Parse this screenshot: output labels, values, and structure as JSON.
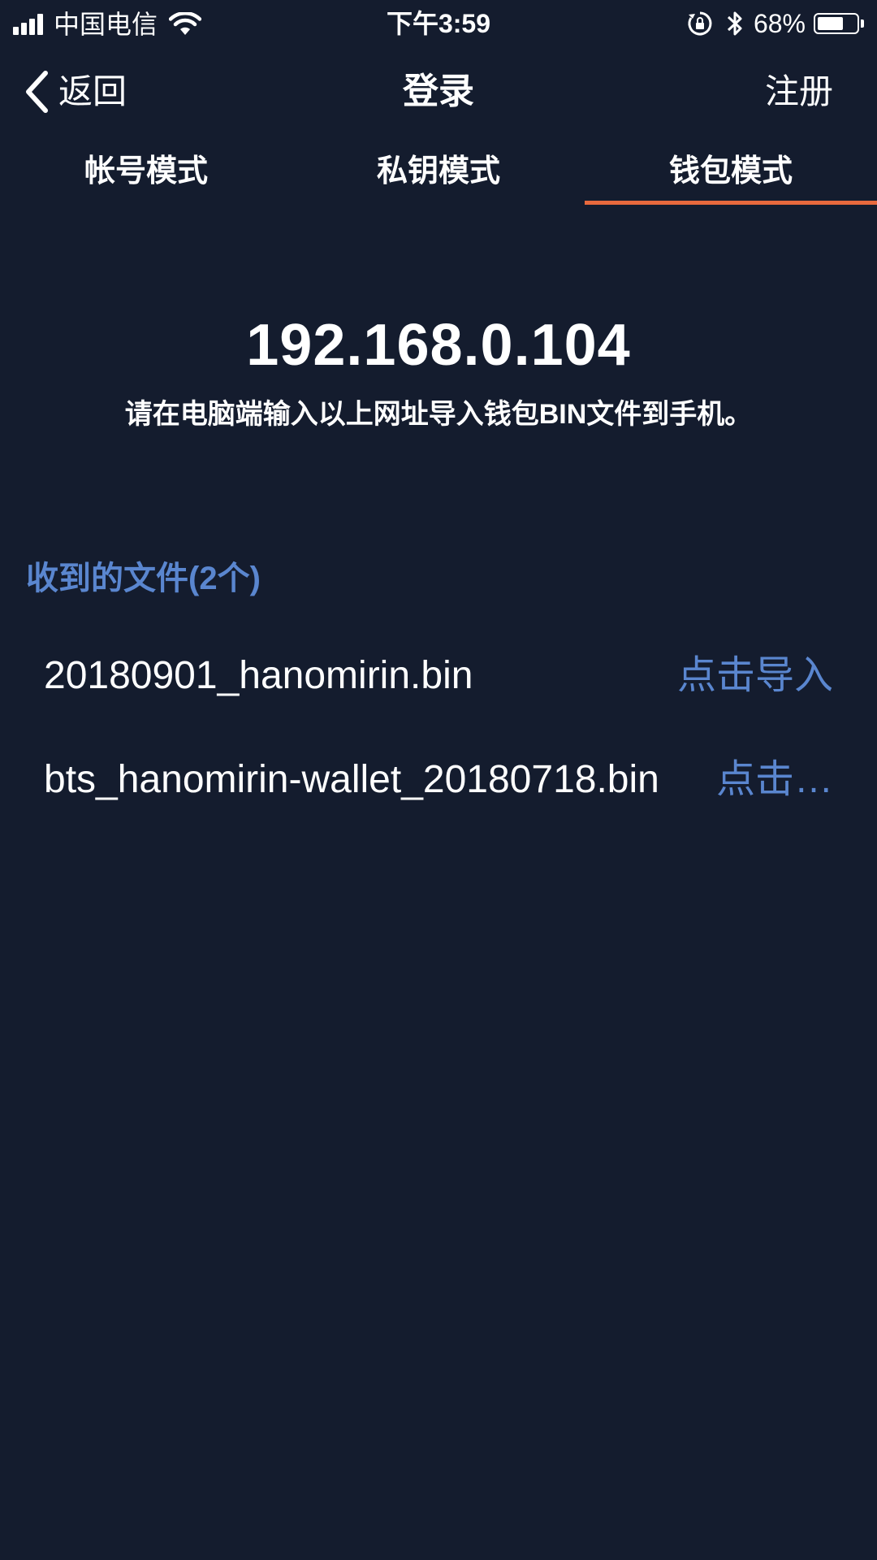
{
  "status_bar": {
    "carrier": "中国电信",
    "time": "下午3:59",
    "battery_percent": "68%",
    "battery_level": 0.68,
    "icons": [
      "signal-icon",
      "wifi-icon",
      "rotation-lock-icon",
      "bluetooth-icon",
      "battery-icon"
    ]
  },
  "nav": {
    "back_label": "返回",
    "title": "登录",
    "register_label": "注册"
  },
  "tabs": [
    {
      "label": "帐号模式",
      "active": false
    },
    {
      "label": "私钥模式",
      "active": false
    },
    {
      "label": "钱包模式",
      "active": true
    }
  ],
  "address": {
    "ip": "192.168.0.104",
    "hint": "请在电脑端输入以上网址导入钱包BIN文件到手机。"
  },
  "received": {
    "title": "收到的文件(2个)",
    "files": [
      {
        "name": "20180901_hanomirin.bin",
        "action": "点击导入"
      },
      {
        "name": "bts_hanomirin-wallet_20180718.bin",
        "action": "点击…"
      }
    ]
  },
  "colors": {
    "background": "#141c2e",
    "accent": "#e8693d",
    "link": "#5a86cf"
  }
}
